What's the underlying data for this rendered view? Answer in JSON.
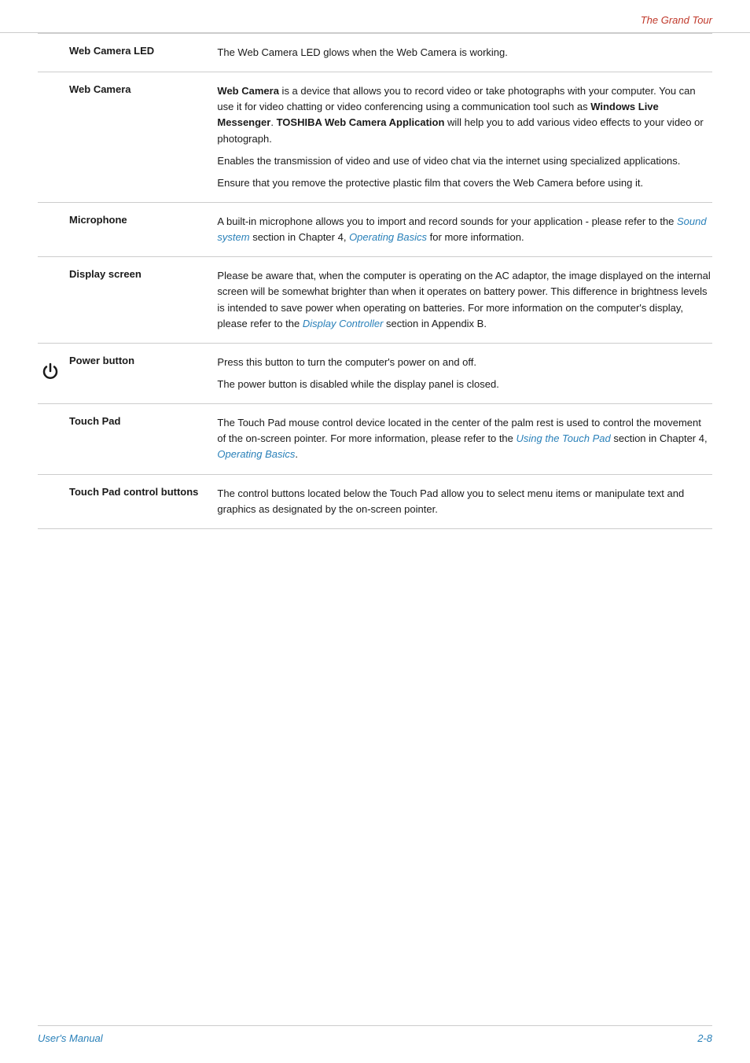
{
  "header": {
    "title": "The Grand Tour"
  },
  "footer": {
    "left": "User's Manual",
    "right": "2-8"
  },
  "table": {
    "rows": [
      {
        "id": "web-camera-led",
        "term": "Web Camera LED",
        "has_icon": false,
        "paragraphs": [
          "The Web Camera LED glows when the Web Camera is working."
        ],
        "links": []
      },
      {
        "id": "web-camera",
        "term": "Web Camera",
        "has_icon": false,
        "paragraphs": [
          "Web Camera is a device that allows you to record video or take photographs with your computer. You can use it for video chatting or video conferencing using a communication tool such as Windows Live Messenger. TOSHIBA Web Camera Application will help you to add various video effects to your video or photograph.",
          "Enables the transmission of video and use of video chat via the internet using specialized applications.",
          "Ensure that you remove the protective plastic film that covers the Web Camera before using it."
        ],
        "bold_phrases": [
          "Web Camera",
          "Windows Live Messenger",
          "TOSHIBA Web Camera Application"
        ],
        "links": []
      },
      {
        "id": "microphone",
        "term": "Microphone",
        "has_icon": false,
        "paragraphs": [
          "A built-in microphone allows you to import and record sounds for your application - please refer to the {Sound system} section in Chapter 4, {Operating Basics} for more information."
        ],
        "links": [
          {
            "text": "Sound system",
            "href": "#"
          },
          {
            "text": "Operating Basics",
            "href": "#"
          }
        ]
      },
      {
        "id": "display-screen",
        "term": "Display screen",
        "has_icon": false,
        "paragraphs": [
          "Please be aware that, when the computer is operating on the AC adaptor, the image displayed on the internal screen will be somewhat brighter than when it operates on battery power. This difference in brightness levels is intended to save power when operating on batteries. For more information on the computer's display, please refer to the {Display Controller} section in Appendix B."
        ],
        "links": [
          {
            "text": "Display Controller",
            "href": "#"
          }
        ]
      },
      {
        "id": "power-button",
        "term": "Power button",
        "has_icon": true,
        "paragraphs": [
          "Press this button to turn the computer's power on and off.",
          "The power button is disabled while the display panel is closed."
        ],
        "links": []
      },
      {
        "id": "touch-pad",
        "term": "Touch Pad",
        "has_icon": false,
        "paragraphs": [
          "The Touch Pad mouse control device located in the center of the palm rest is used to control the movement of the on-screen pointer. For more information, please refer to the {Using the Touch Pad} section in Chapter 4, {Operating Basics}."
        ],
        "links": [
          {
            "text": "Using the Touch Pad",
            "href": "#"
          },
          {
            "text": "Operating Basics",
            "href": "#"
          }
        ]
      },
      {
        "id": "touch-pad-control",
        "term": "Touch Pad control buttons",
        "has_icon": false,
        "paragraphs": [
          "The control buttons located below the Touch Pad allow you to select menu items or manipulate text and graphics as designated by the on-screen pointer."
        ],
        "links": []
      }
    ]
  }
}
